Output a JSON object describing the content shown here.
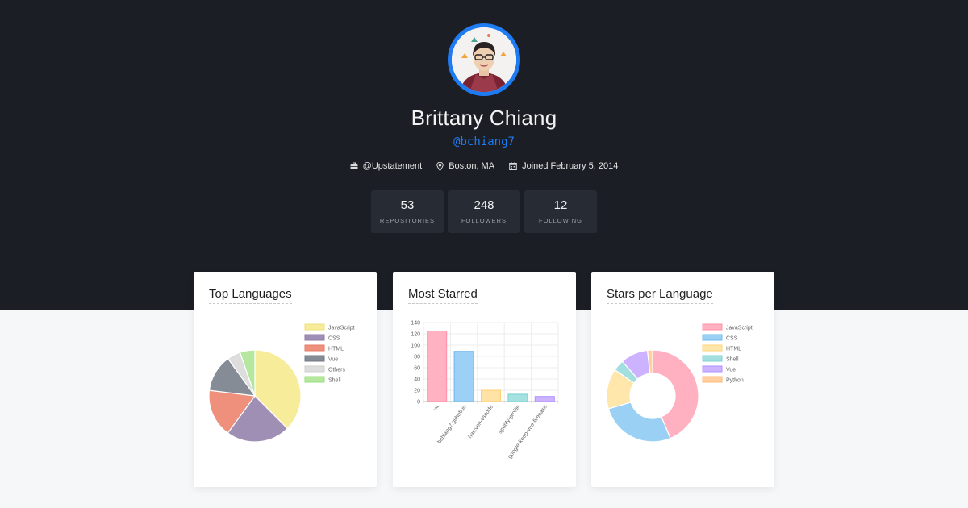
{
  "profile": {
    "name": "Brittany Chiang",
    "handle": "@bchiang7",
    "company": "@Upstatement",
    "location": "Boston, MA",
    "joined": "Joined February 5, 2014"
  },
  "stats": [
    {
      "value": "53",
      "label": "REPOSITORIES"
    },
    {
      "value": "248",
      "label": "FOLLOWERS"
    },
    {
      "value": "12",
      "label": "FOLLOWING"
    }
  ],
  "colors": {
    "hero_bg": "#1b1e24",
    "accent": "#1f7bf2",
    "stat_bg": "#272b33"
  },
  "chart_data": [
    {
      "type": "pie",
      "title": "Top Languages",
      "legend_position": "right",
      "labels": [
        "JavaScript",
        "CSS",
        "HTML",
        "Vue",
        "Others",
        "Shell"
      ],
      "values": [
        20,
        12,
        9,
        7,
        2.5,
        2.8
      ],
      "colors": [
        "#f7ec99",
        "#a08fb4",
        "#ee907b",
        "#858c95",
        "#dddddd",
        "#b5e89e"
      ],
      "border_colors": [
        "#efe17a",
        "#8f7ea8",
        "#e57e68",
        "#737a83",
        "#cfcfcf",
        "#9bdc7f"
      ]
    },
    {
      "type": "bar",
      "title": "Most Starred",
      "categories": [
        "v4",
        "bchiang7.github.io",
        "halcyon-vscode",
        "spotify-profile",
        "google-keep-vue-firebase"
      ],
      "values": [
        125,
        89,
        20,
        13,
        9
      ],
      "ylim": [
        0,
        140
      ],
      "yticks": [
        0,
        20,
        40,
        60,
        80,
        100,
        120,
        140
      ],
      "colors": [
        "#ffb2c1",
        "#9dd0f5",
        "#ffe2a6",
        "#a5e1e0",
        "#cbb3ff"
      ],
      "border_colors": [
        "#ff8fa6",
        "#6db6ec",
        "#ffcf70",
        "#78d2d0",
        "#b28fff"
      ],
      "grid": true
    },
    {
      "type": "pie",
      "title": "Stars per Language",
      "legend_position": "right",
      "labels": [
        "JavaScript",
        "CSS",
        "HTML",
        "Shell",
        "Vue",
        "Python"
      ],
      "values": [
        145,
        89,
        47,
        13,
        32,
        6
      ],
      "colors": [
        "#ffb1c1",
        "#9bd0f5",
        "#ffe6aa",
        "#a4dfdf",
        "#ccb2ff",
        "#ffcf9f"
      ],
      "border_colors": [
        "#ff90a8",
        "#6cb8ee",
        "#ffd27a",
        "#7fd2d2",
        "#b192ff",
        "#ffb877"
      ]
    }
  ]
}
